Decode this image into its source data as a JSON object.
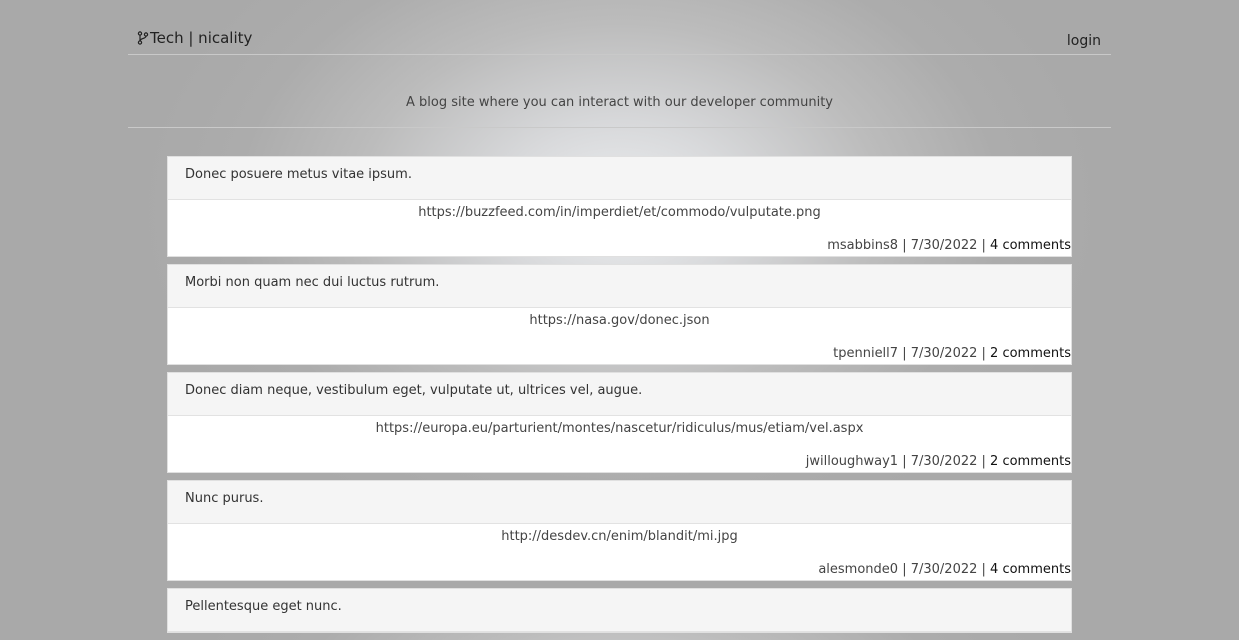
{
  "header": {
    "brand": "Tech | nicality",
    "login_label": "login",
    "tagline": "A blog site where you can interact with our developer community"
  },
  "posts": [
    {
      "title": "Donec posuere metus vitae ipsum.",
      "url": "https://buzzfeed.com/in/imperdiet/et/commodo/vulputate.png",
      "author": "msabbins8",
      "date": "7/30/2022",
      "comments": "4 comments"
    },
    {
      "title": "Morbi non quam nec dui luctus rutrum.",
      "url": "https://nasa.gov/donec.json",
      "author": "tpenniell7",
      "date": "7/30/2022",
      "comments": "2 comments"
    },
    {
      "title": "Donec diam neque, vestibulum eget, vulputate ut, ultrices vel, augue.",
      "url": "https://europa.eu/parturient/montes/nascetur/ridiculus/mus/etiam/vel.aspx",
      "author": "jwilloughway1",
      "date": "7/30/2022",
      "comments": "2 comments"
    },
    {
      "title": "Nunc purus.",
      "url": "http://desdev.cn/enim/blandit/mi.jpg",
      "author": "alesmonde0",
      "date": "7/30/2022",
      "comments": "4 comments"
    },
    {
      "title": "Pellentesque eget nunc.",
      "url": "",
      "author": "",
      "date": "",
      "comments": ""
    }
  ]
}
